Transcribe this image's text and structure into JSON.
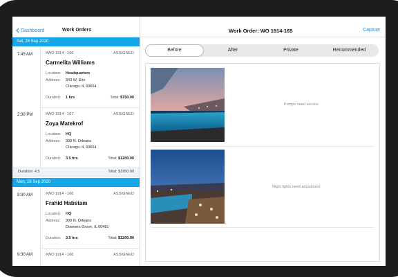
{
  "left": {
    "back_label": "Dashboard",
    "title": "Work Orders",
    "groups": [
      {
        "date": "Sat, 26 Sep 2020",
        "orders": [
          {
            "time": "7:45 AM",
            "wo": "#WO 1914 - 166",
            "status": "ASSIGNED",
            "name": "Carmelita Williams",
            "location": "Headquarters",
            "address1": "343 W. Erie",
            "address2": "Chicago, IL 60654",
            "duration": "1 hrs",
            "total": "$750.00"
          },
          {
            "time": "2:30 PM",
            "wo": "#WO 1914 - 167",
            "status": "ASSIGNED",
            "name": "Zoya Matekrof",
            "location": "HQ",
            "address1": "300 N. Orleans",
            "address2": "Chicago, IL 60654",
            "duration": "3.5 hrs",
            "total": "$1200.00"
          }
        ],
        "summary": {
          "duration": "Duration: 4.5",
          "total": "Total: $1950.00"
        }
      },
      {
        "date": "Mon, 28 Sep 2020",
        "orders": [
          {
            "time": "9:30 AM",
            "wo": "#WO 1914 - 166",
            "status": "ASSIGNED",
            "name": "Frahid Habstam",
            "location": "HQ",
            "address1": "300 N. Orleans",
            "address2": "Downers Grove, IL 60481",
            "duration": "3.5 hrs",
            "total": "$1200.00"
          },
          {
            "time": "9:30 AM",
            "wo": "#WO 1914 - 166",
            "status": "ASSIGNED"
          }
        ]
      }
    ],
    "labels": {
      "location": "Location:",
      "address": "Address:",
      "duration": "Duration:",
      "total": "Total:"
    }
  },
  "right": {
    "title": "Work Order: WO 1914-165",
    "capture": "Capture",
    "tabs": [
      "Before",
      "After",
      "Private",
      "Recommended"
    ],
    "active_tab": "Before",
    "items": [
      {
        "note": "Pumps need service"
      },
      {
        "note": "Night lights need adjustment"
      }
    ]
  },
  "colors": {
    "accent": "#1a8fe3",
    "date_bar": "#14a8e8"
  }
}
